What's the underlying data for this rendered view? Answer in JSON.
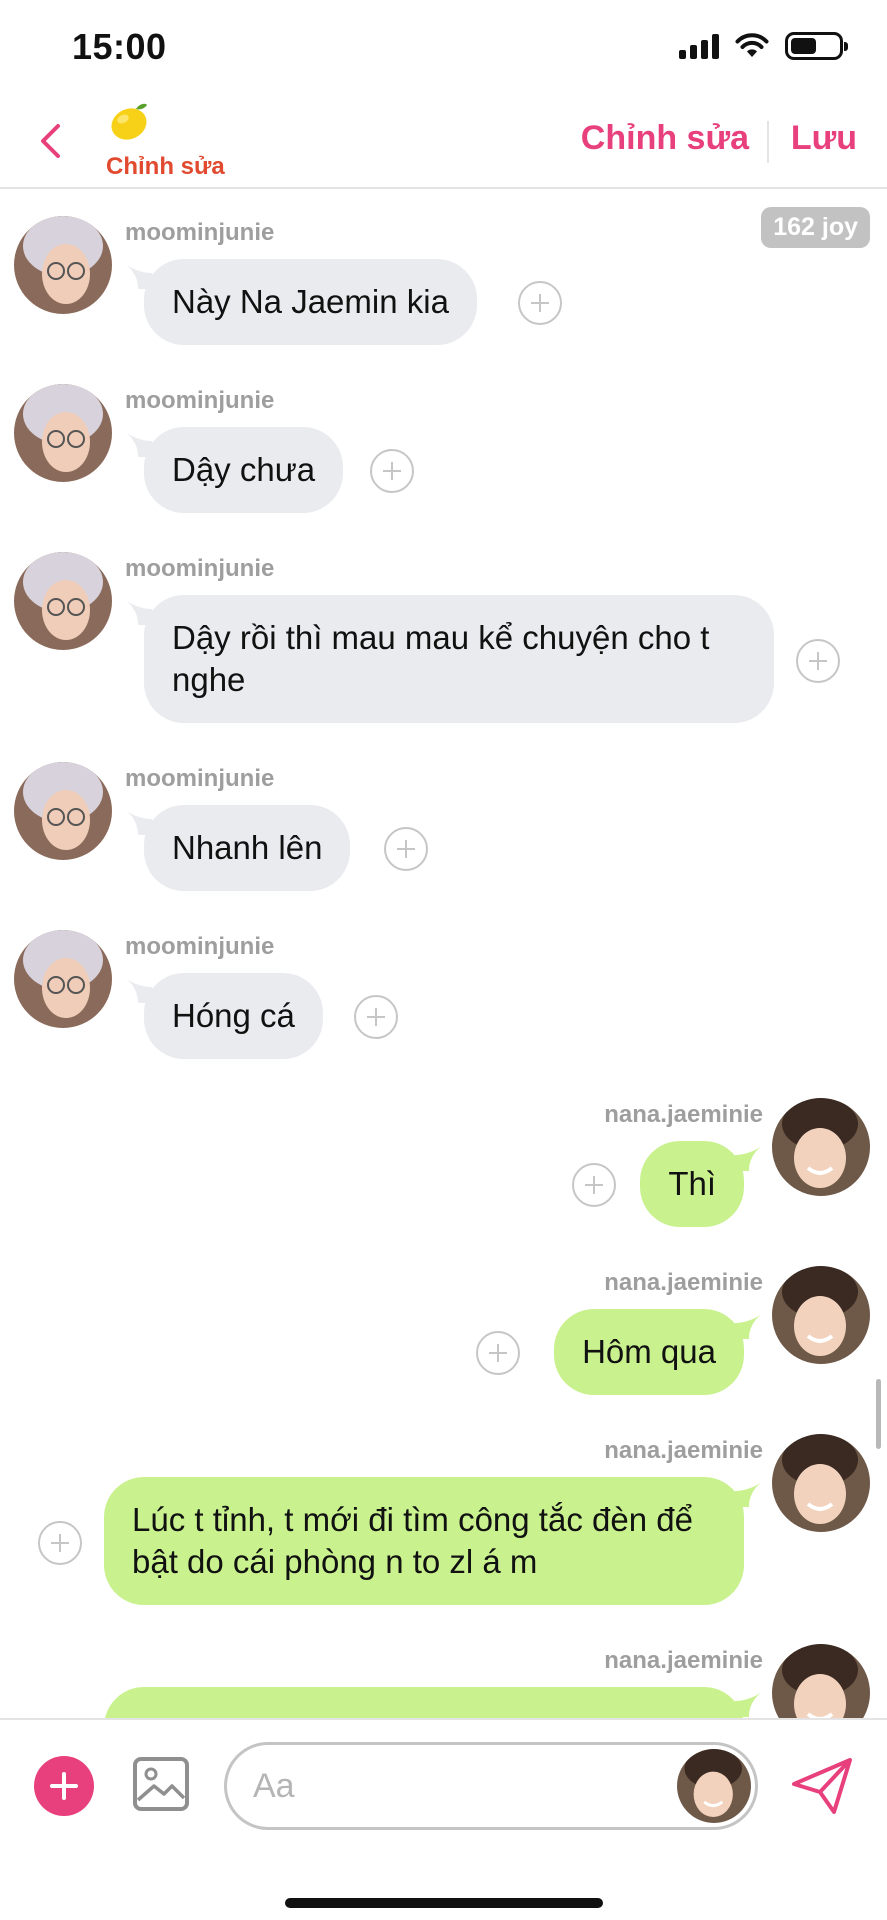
{
  "status_bar": {
    "time": "15:00"
  },
  "header": {
    "emoji_icon": "lemon-icon",
    "subtitle": "Chỉnh sửa",
    "edit_label": "Chỉnh sửa",
    "save_label": "Lưu",
    "accent_color": "#e8407c"
  },
  "chat": {
    "joy_badge": "162 joy",
    "messages": [
      {
        "side": "in",
        "user": "moominjunie",
        "text": "Này Na Jaemin kia"
      },
      {
        "side": "in",
        "user": "moominjunie",
        "text": "Dậy chưa"
      },
      {
        "side": "in",
        "user": "moominjunie",
        "text": "Dậy rồi thì mau mau kể chuyện cho t nghe"
      },
      {
        "side": "in",
        "user": "moominjunie",
        "text": "Nhanh lên"
      },
      {
        "side": "in",
        "user": "moominjunie",
        "text": "Hóng cá"
      },
      {
        "side": "out",
        "user": "nana.jaeminie",
        "text": "Thì"
      },
      {
        "side": "out",
        "user": "nana.jaeminie",
        "text": "Hôm qua"
      },
      {
        "side": "out",
        "user": "nana.jaeminie",
        "text": "Lúc t tỉnh, t mới đi tìm công tắc đèn để bật do cái phòng n to zl á m"
      },
      {
        "side": "out",
        "user": "nana.jaeminie",
        "text": ""
      }
    ]
  },
  "composer": {
    "placeholder": "Aa",
    "add_icon": "plus-icon",
    "image_icon": "image-icon",
    "send_icon": "send-icon"
  }
}
